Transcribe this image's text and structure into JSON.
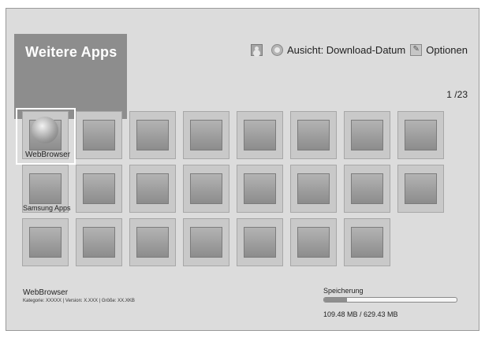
{
  "header": {
    "title": "Weitere Apps",
    "sort_label": "Ausicht: Download-Datum",
    "options_label": "Optionen"
  },
  "page_indicator": "1 /23",
  "apps": {
    "webbrowser_label": "WebBrowser",
    "samsung_apps_label": "Samsung Apps"
  },
  "info": {
    "name": "WebBrowser",
    "meta": "Kategorie: XXXXX | Version: X.XXX | Größe: XX.XKB"
  },
  "storage": {
    "label": "Speicherung",
    "value": "109.48 MB / 629.43 MB",
    "used_fraction": 0.17
  },
  "icons": {
    "user": "user-icon",
    "sort": "sort-icon",
    "options": "options-icon",
    "app": "globe-icon"
  }
}
